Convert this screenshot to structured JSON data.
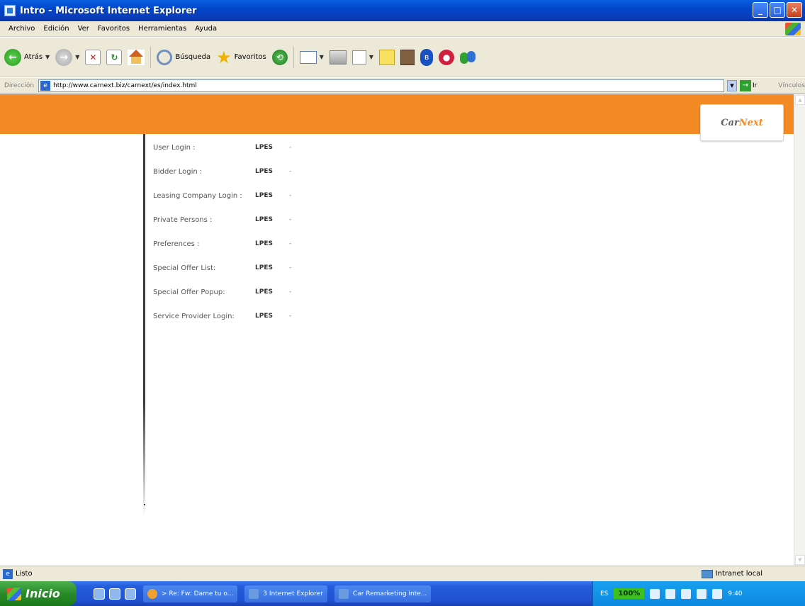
{
  "window": {
    "title": "Intro - Microsoft Internet Explorer",
    "buttons": {
      "minimize": "_",
      "maximize": "□",
      "close": "✕"
    }
  },
  "menu": [
    "Archivo",
    "Edición",
    "Ver",
    "Favoritos",
    "Herramientas",
    "Ayuda"
  ],
  "toolbar": {
    "back_label": "Atrás",
    "search_label": "Búsqueda",
    "favorites_label": "Favoritos"
  },
  "address": {
    "label": "Dirección",
    "url": "http://www.carnext.biz/carnext/es/index.html",
    "go_label": "Ir",
    "links_label": "Vínculos"
  },
  "logo": {
    "part1": "Car",
    "part2": "Next"
  },
  "login_links": [
    {
      "label": "User Login :",
      "code": "LPES",
      "dash": "-"
    },
    {
      "label": "Bidder Login :",
      "code": "LPES",
      "dash": "-"
    },
    {
      "label": "Leasing Company Login :",
      "code": "LPES",
      "dash": "-"
    },
    {
      "label": "Private Persons :",
      "code": "LPES",
      "dash": "-"
    },
    {
      "label": "Preferences :",
      "code": "LPES",
      "dash": "-"
    },
    {
      "label": "Special Offer List:",
      "code": "LPES",
      "dash": "-"
    },
    {
      "label": "Special Offer Popup:",
      "code": "LPES",
      "dash": "-"
    },
    {
      "label": "Service Provider Login:",
      "code": "LPES",
      "dash": "-"
    }
  ],
  "status": {
    "text": "Listo",
    "zone": "Intranet local"
  },
  "taskbar": {
    "start_label": "Inicio",
    "tasks": [
      "> Re: Fw: Dame tu o...",
      "3 Internet Explorer",
      "Car Remarketing Inte..."
    ],
    "lang": "ES",
    "battery": "100%",
    "clock": "9:40"
  },
  "colors": {
    "accent_orange": "#f38a24",
    "title_blue": "#0047c8"
  }
}
